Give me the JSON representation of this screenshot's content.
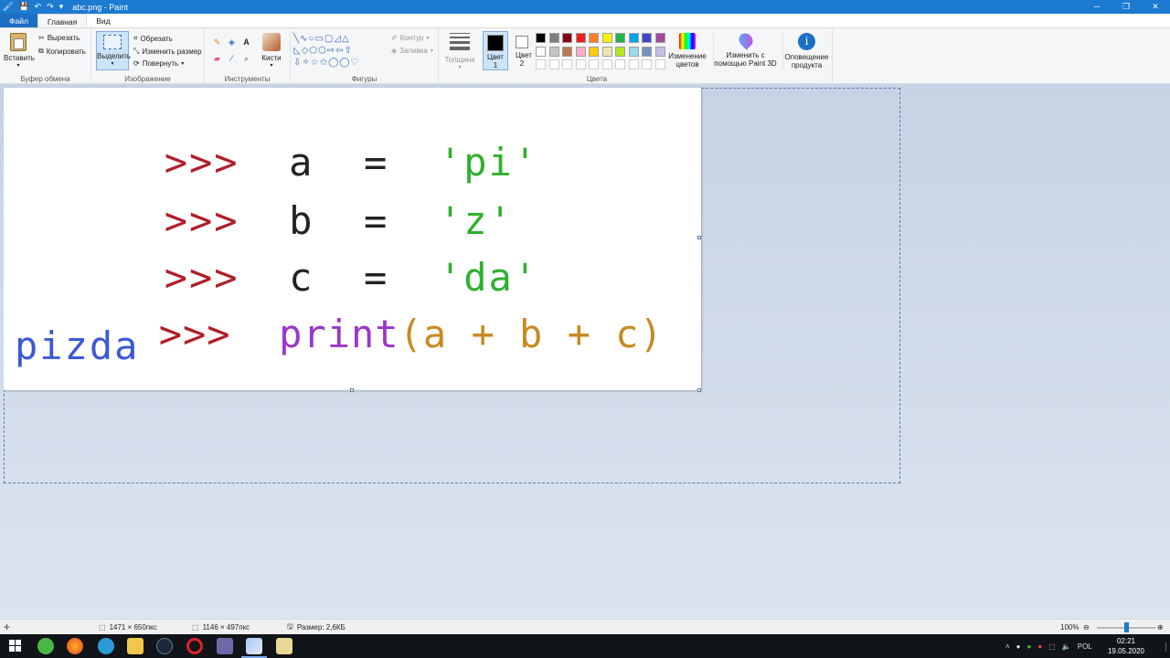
{
  "window": {
    "title": "abc.png - Paint",
    "controls": [
      "─",
      "❐",
      "✕"
    ]
  },
  "tabs": [
    {
      "label": "Файл"
    },
    {
      "label": "Главная"
    },
    {
      "label": "Вид"
    }
  ],
  "ribbon": {
    "clipboard": {
      "paste": "Вставить",
      "cut": "Вырезать",
      "copy": "Копировать",
      "label": "Буфер обмена"
    },
    "image": {
      "select": "Выделить",
      "crop": "Обрезать",
      "resize": "Изменить размер",
      "rotate": "Повернуть",
      "label": "Изображение"
    },
    "tools": {
      "brushes": "Кисти",
      "label": "Инструменты"
    },
    "shapes": {
      "outline": "Контур",
      "fill": "Заливка",
      "label": "Фигуры"
    },
    "thickness": "Толщина",
    "colors": {
      "color1": "Цвет 1",
      "color2": "Цвет 2",
      "edit": "Изменение цветов",
      "paint3d": "Изменить с помощью Paint 3D",
      "alert": "Оповещение продукта",
      "label": "Цвета",
      "palette_row1": [
        "#000000",
        "#7f7f7f",
        "#880015",
        "#ed1c24",
        "#ff7f27",
        "#fff200",
        "#22b14c",
        "#00a2e8",
        "#3f48cc",
        "#a349a4"
      ],
      "palette_row2": [
        "#ffffff",
        "#c3c3c3",
        "#b97a57",
        "#ffaec9",
        "#ffc90e",
        "#efe4b0",
        "#b5e61d",
        "#99d9ea",
        "#7092be",
        "#c8bfe7"
      ],
      "color1_value": "#000000",
      "color2_value": "#ffffff"
    }
  },
  "canvas": {
    "lines": [
      {
        "prompt": ">>>",
        "var": "a",
        "op": "=",
        "value": "'pi'"
      },
      {
        "prompt": ">>>",
        "var": "b",
        "op": "=",
        "value": "'z'"
      },
      {
        "prompt": ">>>",
        "var": "c",
        "op": "=",
        "value": "'da'"
      },
      {
        "prompt": ">>>",
        "fn": "print",
        "args": "(a + b + c)"
      }
    ],
    "output": "pizda"
  },
  "statusbar": {
    "selection_size": "1471 × 650пкс",
    "image_size": "1146 × 497пкс",
    "file_size": "Размер: 2,6КБ",
    "zoom": "100%",
    "zoom_level_percent": 100
  },
  "taskbar": {
    "language": "POL",
    "time": "02:21",
    "date": "19.05.2020"
  }
}
